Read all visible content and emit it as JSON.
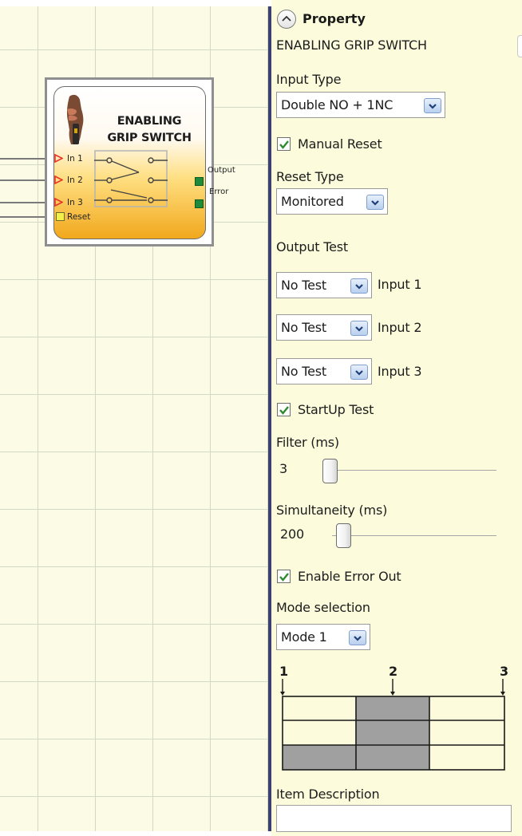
{
  "block": {
    "title_line1": "ENABLING",
    "title_line2": "GRIP SWITCH",
    "inputs": [
      "In 1",
      "In 2",
      "In 3",
      "Reset"
    ],
    "outputs": [
      "Output",
      "Error"
    ]
  },
  "panel": {
    "header": "Property",
    "item_name": "ENABLING GRIP SWITCH",
    "input_type": {
      "label": "Input Type",
      "value": "Double NO + 1NC"
    },
    "manual_reset": {
      "label": "Manual Reset",
      "checked": true
    },
    "reset_type": {
      "label": "Reset Type",
      "value": "Monitored"
    },
    "output_test": {
      "label": "Output Test",
      "rows": [
        {
          "value": "No Test",
          "label": "Input 1"
        },
        {
          "value": "No Test",
          "label": "Input 2"
        },
        {
          "value": "No Test",
          "label": "Input 3"
        }
      ]
    },
    "startup_test": {
      "label": "StartUp Test",
      "checked": true
    },
    "filter": {
      "label": "Filter (ms)",
      "value": "3"
    },
    "simultaneity": {
      "label": "Simultaneity (ms)",
      "value": "200"
    },
    "enable_error_out": {
      "label": "Enable Error Out",
      "checked": true
    },
    "mode_selection": {
      "label": "Mode selection",
      "value": "Mode 1"
    },
    "mode_diagram": {
      "positions": [
        "1",
        "2",
        "3"
      ],
      "rows": [
        [
          false,
          true,
          false
        ],
        [
          false,
          true,
          false
        ],
        [
          true,
          true,
          false
        ]
      ]
    },
    "item_description": {
      "label": "Item Description",
      "value": ""
    }
  },
  "colors": {
    "canvas_bg": "#fbfbe6",
    "panel_bg": "#fcfcdd",
    "divider": "#3a4170",
    "output_port": "#1f8a3a",
    "input_arrow": "#e8332a",
    "reset_port": "#f2f04a",
    "block_gradient_bottom": "#f1a81c",
    "check": "#2e8b2e",
    "diagram_fill": "#a0a0a0"
  }
}
